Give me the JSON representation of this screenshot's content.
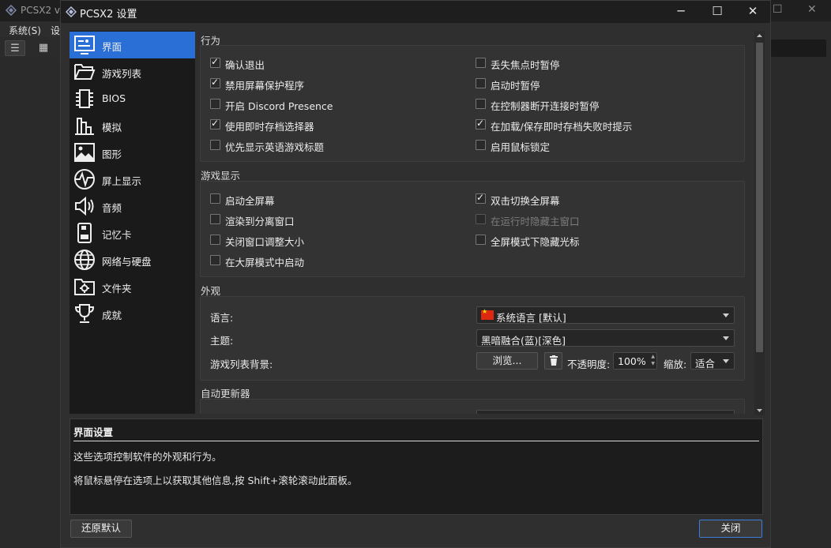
{
  "background_window": {
    "title": "PCSX2 v...",
    "menus": [
      "系统(S)",
      "设"
    ],
    "toolbar": [
      "list-view-icon",
      "grid-view-icon"
    ]
  },
  "dialog": {
    "title": "PCSX2 设置",
    "window_controls": {
      "minimize": "─",
      "maximize": "☐",
      "close": "✕"
    }
  },
  "sidebar": {
    "items": [
      {
        "label": "界面",
        "icon": "interface-icon",
        "active": true
      },
      {
        "label": "游戏列表",
        "icon": "folder-open-icon",
        "active": false
      },
      {
        "label": "BIOS",
        "icon": "chip-icon",
        "active": false
      },
      {
        "label": "模拟",
        "icon": "emulation-icon",
        "active": false
      },
      {
        "label": "图形",
        "icon": "image-icon",
        "active": false
      },
      {
        "label": "屏上显示",
        "icon": "pulse-icon",
        "active": false
      },
      {
        "label": "音频",
        "icon": "speaker-icon",
        "active": false
      },
      {
        "label": "记忆卡",
        "icon": "memory-card-icon",
        "active": false
      },
      {
        "label": "网络与硬盘",
        "icon": "globe-icon",
        "active": false
      },
      {
        "label": "文件夹",
        "icon": "folder-settings-icon",
        "active": false
      },
      {
        "label": "成就",
        "icon": "trophy-icon",
        "active": false
      }
    ]
  },
  "behavior": {
    "title": "行为",
    "left": [
      {
        "label": "确认退出",
        "checked": true
      },
      {
        "label": "禁用屏幕保护程序",
        "checked": true
      },
      {
        "label": "开启 Discord Presence",
        "checked": false
      },
      {
        "label": "使用即时存档选择器",
        "checked": true
      },
      {
        "label": "优先显示英语游戏标题",
        "checked": false
      }
    ],
    "right": [
      {
        "label": "丢失焦点时暂停",
        "checked": false
      },
      {
        "label": "启动时暂停",
        "checked": false
      },
      {
        "label": "在控制器断开连接时暂停",
        "checked": false
      },
      {
        "label": "在加载/保存即时存档失败时提示",
        "checked": true
      },
      {
        "label": "启用鼠标锁定",
        "checked": false
      }
    ]
  },
  "game_display": {
    "title": "游戏显示",
    "left": [
      {
        "label": "启动全屏幕",
        "checked": false
      },
      {
        "label": "渲染到分离窗口",
        "checked": false
      },
      {
        "label": "关闭窗口调整大小",
        "checked": false
      },
      {
        "label": "在大屏模式中启动",
        "checked": false
      }
    ],
    "right": [
      {
        "label": "双击切换全屏幕",
        "checked": true,
        "disabled": false
      },
      {
        "label": "在运行时隐藏主窗口",
        "checked": false,
        "disabled": true
      },
      {
        "label": "全屏模式下隐藏光标",
        "checked": false,
        "disabled": false
      }
    ]
  },
  "appearance": {
    "title": "外观",
    "language_label": "语言:",
    "language_value": "系统语言 [默认]",
    "theme_label": "主题:",
    "theme_value": "黑暗融合(蓝)[深色]",
    "background_label": "游戏列表背景:",
    "browse_label": "浏览...",
    "opacity_label": "不透明度:",
    "opacity_value": "100%",
    "scale_label": "缩放:",
    "scale_value": "适合"
  },
  "auto_updater": {
    "title": "自动更新器"
  },
  "help": {
    "title": "界面设置",
    "line1": "这些选项控制软件的外观和行为。",
    "line2": "将鼠标悬停在选项上以获取其他信息,按 Shift+滚轮滚动此面板。"
  },
  "footer": {
    "reset_label": "还原默认",
    "close_label": "关闭"
  },
  "colors": {
    "accent": "#2a6fd6",
    "background": "#2f2f2f",
    "sidebar": "#1a1a1a"
  }
}
